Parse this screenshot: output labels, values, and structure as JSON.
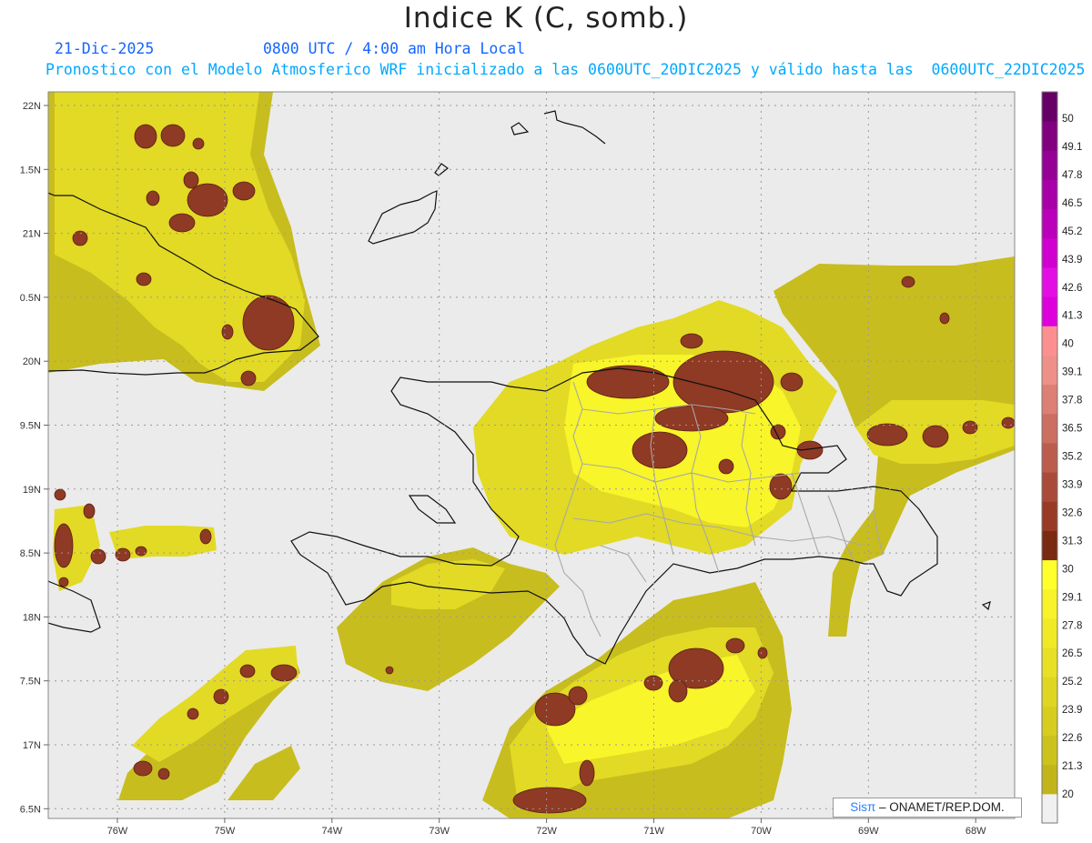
{
  "header": {
    "title": "Indice K (C, somb.)",
    "date": "21-Dic-2025",
    "time": "0800 UTC / 4:00 am Hora Local",
    "description": "Pronostico con el Modelo Atmosferico WRF inicializado a las 0600UTC_20DIC2025 y válido hasta las  0600UTC_22DIC2025"
  },
  "axes": {
    "lon_labels": [
      "76W",
      "75W",
      "74W",
      "73W",
      "72W",
      "71W",
      "70W",
      "69W",
      "68W"
    ],
    "lat_labels": [
      "22N",
      "1.5N",
      "21N",
      "0.5N",
      "20N",
      "9.5N",
      "19N",
      "8.5N",
      "18N",
      "7.5N",
      "17N",
      "6.5N"
    ]
  },
  "colorbar": {
    "labels": [
      "50",
      "49.1",
      "47.8",
      "46.5",
      "45.2",
      "43.9",
      "42.6",
      "41.3",
      "40",
      "39.1",
      "37.8",
      "36.5",
      "35.2",
      "33.9",
      "32.6",
      "31.3",
      "30",
      "29.1",
      "27.8",
      "26.5",
      "25.2",
      "23.9",
      "22.6",
      "21.3",
      "20"
    ],
    "colors": [
      "#f0f0f0",
      "#c2b51a",
      "#ccc21c",
      "#d6cd1f",
      "#dfd622",
      "#e8e024",
      "#f0e926",
      "#f7f229",
      "#ffff2b",
      "#7a2a10",
      "#993a24",
      "#aa4a3a",
      "#bb5c4c",
      "#cc6e60",
      "#dd7f74",
      "#ee9088",
      "#fc9090",
      "#dd00dd",
      "#e40ee4",
      "#d000d0",
      "#bb00bb",
      "#a800a8",
      "#950095",
      "#800080",
      "#660066"
    ]
  },
  "field_colors": {
    "background": "#ebebeb",
    "low": "#c8bd1e",
    "mid": "#e2da25",
    "high": "#f8f52a",
    "hot": "#8e3a24",
    "coast": "#111111",
    "border": "#a8a8a8",
    "grid": "#9a9a9a"
  },
  "credit": {
    "brand": "Sisπ",
    "org": "– ONAMET/REP.DOM."
  }
}
